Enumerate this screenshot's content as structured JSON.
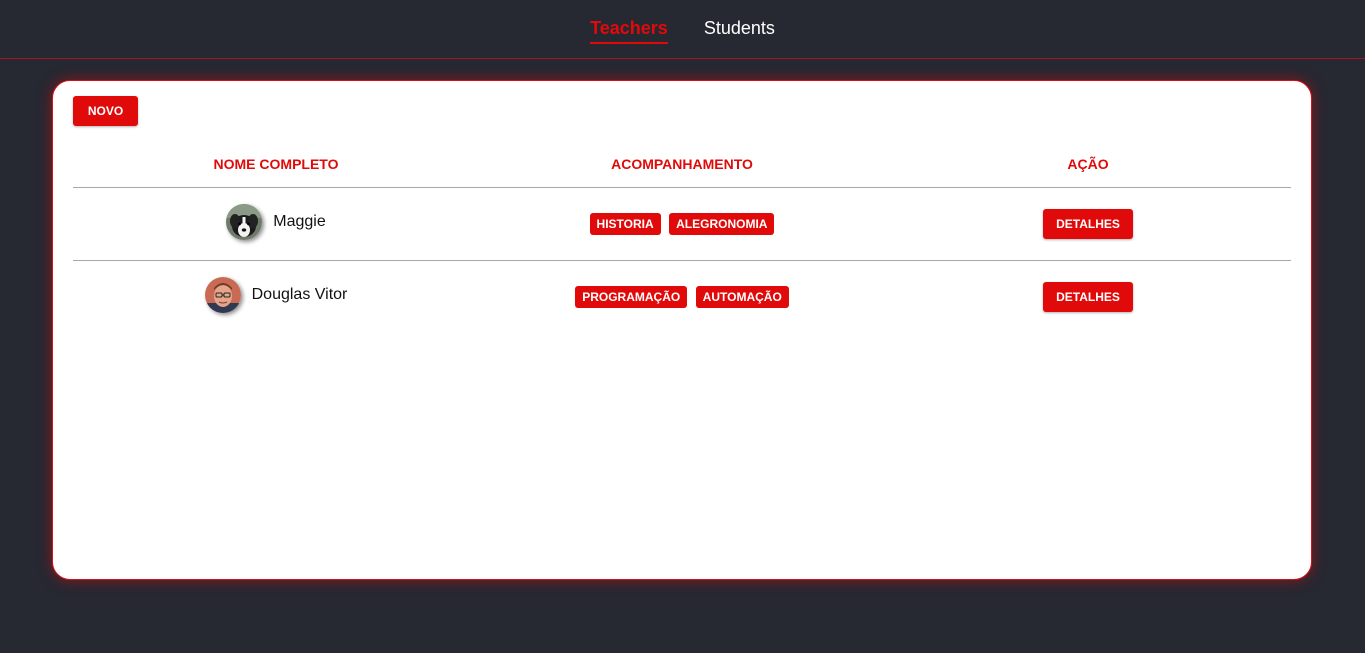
{
  "nav": {
    "items": [
      {
        "label": "Teachers",
        "active": true
      },
      {
        "label": "Students",
        "active": false
      }
    ]
  },
  "toolbar": {
    "new_label": "NOVO"
  },
  "table": {
    "headers": [
      "NOME COMPLETO",
      "ACOMPANHAMENTO",
      "AÇÃO"
    ],
    "rows": [
      {
        "name": "Maggie",
        "avatar": "dog-avatar",
        "tags": [
          "HISTORIA",
          "ALEGRONOMIA"
        ],
        "action": "DETALHES"
      },
      {
        "name": "Douglas Vitor",
        "avatar": "person-avatar",
        "tags": [
          "PROGRAMAÇÃO",
          "AUTOMAÇÃO"
        ],
        "action": "DETALHES"
      }
    ]
  },
  "colors": {
    "background": "#262832",
    "accent": "#e10a0a",
    "card": "#ffffff"
  }
}
